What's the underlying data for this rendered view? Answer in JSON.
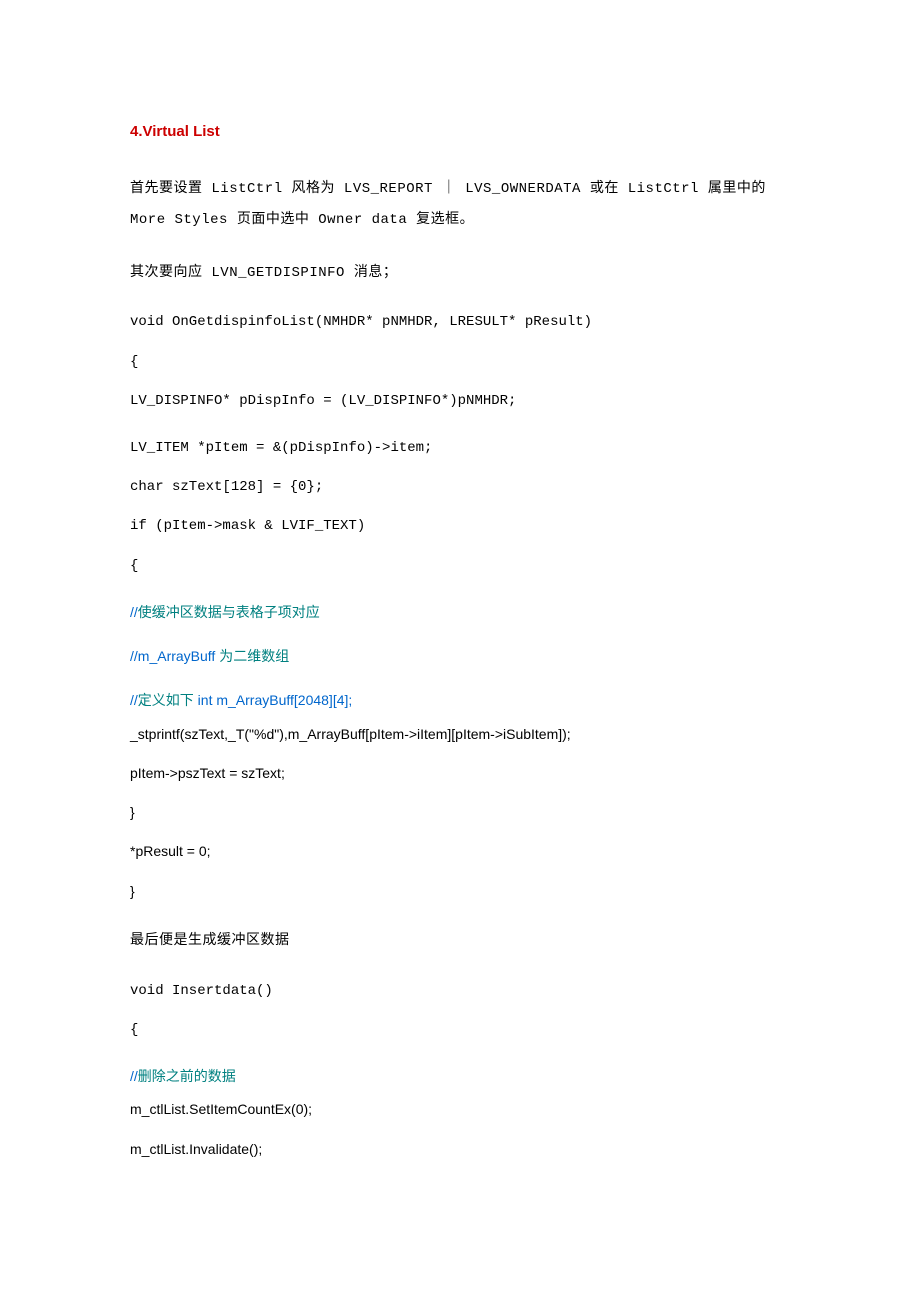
{
  "heading": "4.Virtual List",
  "intro1": "首先要设置 ListCtrl 风格为 LVS_REPORT ｜ LVS_OWNERDATA 或在 ListCtrl 属里中的 More Styles 页面中选中 Owner data 复选框。",
  "intro2": "其次要向应 LVN_GETDISPINFO 消息；",
  "code": {
    "line1": "void OnGetdispinfoList(NMHDR* pNMHDR, LRESULT* pResult)",
    "line2": "{",
    "line3": "LV_DISPINFO* pDispInfo = (LV_DISPINFO*)pNMHDR;",
    "line4": "LV_ITEM *pItem = &(pDispInfo)->item;",
    "line5": "char szText[128] = {0};",
    "line6": "if (pItem->mask & LVIF_TEXT)",
    "line7": "{"
  },
  "comments": {
    "c1_prefix": "//",
    "c1_text": "使缓冲区数据与表格子项对应",
    "c2_prefix": "//m_ArrayBuff ",
    "c2_text": "为二维数组",
    "c3_prefix": "//",
    "c3_teal": "定义如下  ",
    "c3_rest": "int m_ArrayBuff[2048][4];"
  },
  "code2": {
    "line1": "_stprintf(szText,_T(\"%d\"),m_ArrayBuff[pItem->iItem][pItem->iSubItem]);",
    "line2": "pItem->pszText = szText;",
    "line3": "}",
    "line4": "*pResult = 0;",
    "line5": "}"
  },
  "mid1": "最后便是生成缓冲区数据",
  "code3": {
    "line1": "void Insertdata()",
    "line2": "{"
  },
  "comments2": {
    "c4_prefix": "//",
    "c4_text": "删除之前的数据"
  },
  "code4": {
    "line1": "m_ctlList.SetItemCountEx(0);",
    "line2": "m_ctlList.Invalidate();"
  }
}
